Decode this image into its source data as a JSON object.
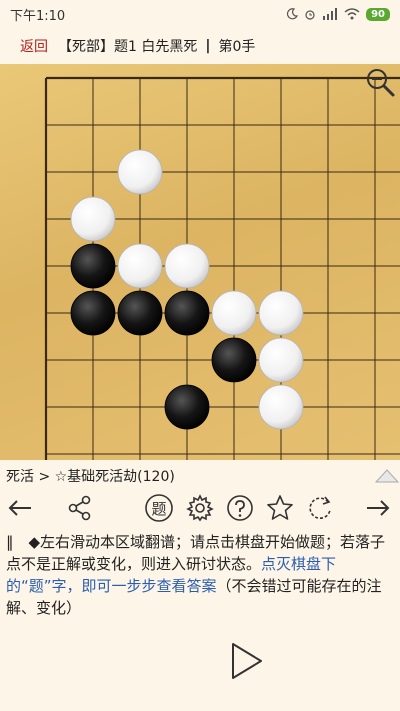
{
  "status_bar": {
    "time": "下午1:10",
    "battery": "90"
  },
  "title_bar": {
    "back": "返回",
    "problem": "【死部】题1 白先黑死",
    "separator": "|",
    "move": "第0手"
  },
  "board": {
    "size": 19,
    "visible_corner": "top-left",
    "stones": [
      {
        "color": "white",
        "col": 2,
        "row": 2
      },
      {
        "color": "white",
        "col": 1,
        "row": 3
      },
      {
        "color": "black",
        "col": 1,
        "row": 4
      },
      {
        "color": "white",
        "col": 2,
        "row": 4
      },
      {
        "color": "white",
        "col": 3,
        "row": 4
      },
      {
        "color": "black",
        "col": 1,
        "row": 5
      },
      {
        "color": "black",
        "col": 2,
        "row": 5
      },
      {
        "color": "black",
        "col": 3,
        "row": 5
      },
      {
        "color": "white",
        "col": 4,
        "row": 5
      },
      {
        "color": "white",
        "col": 5,
        "row": 5
      },
      {
        "color": "black",
        "col": 4,
        "row": 6
      },
      {
        "color": "white",
        "col": 5,
        "row": 6
      },
      {
        "color": "black",
        "col": 3,
        "row": 7
      },
      {
        "color": "white",
        "col": 5,
        "row": 7
      }
    ]
  },
  "breadcrumb": "死活 > ☆基础死活劫(120)",
  "toolbar": {
    "problem_char": "题",
    "icons": [
      "arrow-left-icon",
      "share-icon",
      "problem-icon",
      "settings-icon",
      "help-icon",
      "star-icon",
      "refresh-icon",
      "arrow-right-icon"
    ]
  },
  "comment": {
    "text": "‖　◆左右滑动本区域翻谱；请点击棋盘开始做题；若落子点不是正解或变化，则进入研讨状态。",
    "hint": "点灭棋盘下的“题”字，即可一步步查看答案",
    "tail": "（不会错过可能存在的注解、变化）"
  },
  "colors": {
    "accent_red": "#b22020",
    "link_blue": "#2a5db0",
    "board_wood": "#dcb462"
  }
}
